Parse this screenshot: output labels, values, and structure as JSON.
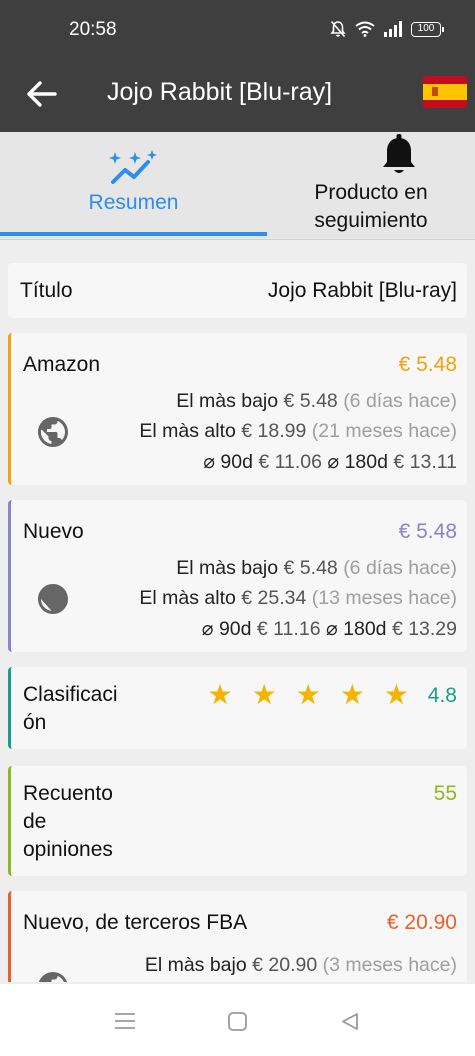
{
  "status": {
    "time": "20:58",
    "battery": "100"
  },
  "appbar": {
    "title": "Jojo Rabbit [Blu-ray]",
    "flag": "spain-flag-icon"
  },
  "tabs": [
    {
      "label": "Resumen",
      "icon": "chart-sparkle-icon",
      "active": true
    },
    {
      "label": "Producto en seguimiento",
      "icon": "bell-icon",
      "active": false
    }
  ],
  "title_row": {
    "label": "Título",
    "value": "Jojo Rabbit [Blu-ray]"
  },
  "amazon": {
    "label": "Amazon",
    "price": "€ 5.48",
    "color": "#f0a30a",
    "low_label": "El màs bajo",
    "low_value": "€ 5.48",
    "low_when": "(6 días hace)",
    "high_label": "El màs alto",
    "high_value": "€ 18.99",
    "high_when": "(21 meses hace)",
    "avg90_label": "⌀ 90d",
    "avg90_value": "€ 11.06",
    "avg180_label": "⌀ 180d",
    "avg180_value": "€ 13.11"
  },
  "nuevo": {
    "label": "Nuevo",
    "price": "€ 5.48",
    "color": "#8a84c8",
    "low_label": "El màs bajo",
    "low_value": "€ 5.48",
    "low_when": "(6 días hace)",
    "high_label": "El màs alto",
    "high_value": "€ 25.34",
    "high_when": "(13 meses hace)",
    "avg90_label": "⌀ 90d",
    "avg90_value": "€ 11.16",
    "avg180_label": "⌀ 180d",
    "avg180_value": "€ 13.29"
  },
  "rating": {
    "label_line1": "Clasificaci",
    "label_line2": "ón",
    "value": "4.8",
    "stars": 5,
    "color": "#1a9e8c"
  },
  "reviews": {
    "label_line1": "Recuento",
    "label_line2": "de",
    "label_line3": "opiniones",
    "value": "55",
    "color": "#8fba1d"
  },
  "fba": {
    "label": "Nuevo, de terceros FBA",
    "price": "€ 20.90",
    "color": "#e8612c",
    "low_label": "El màs bajo",
    "low_value": "€ 20.90",
    "low_when": "(3 meses hace)"
  }
}
